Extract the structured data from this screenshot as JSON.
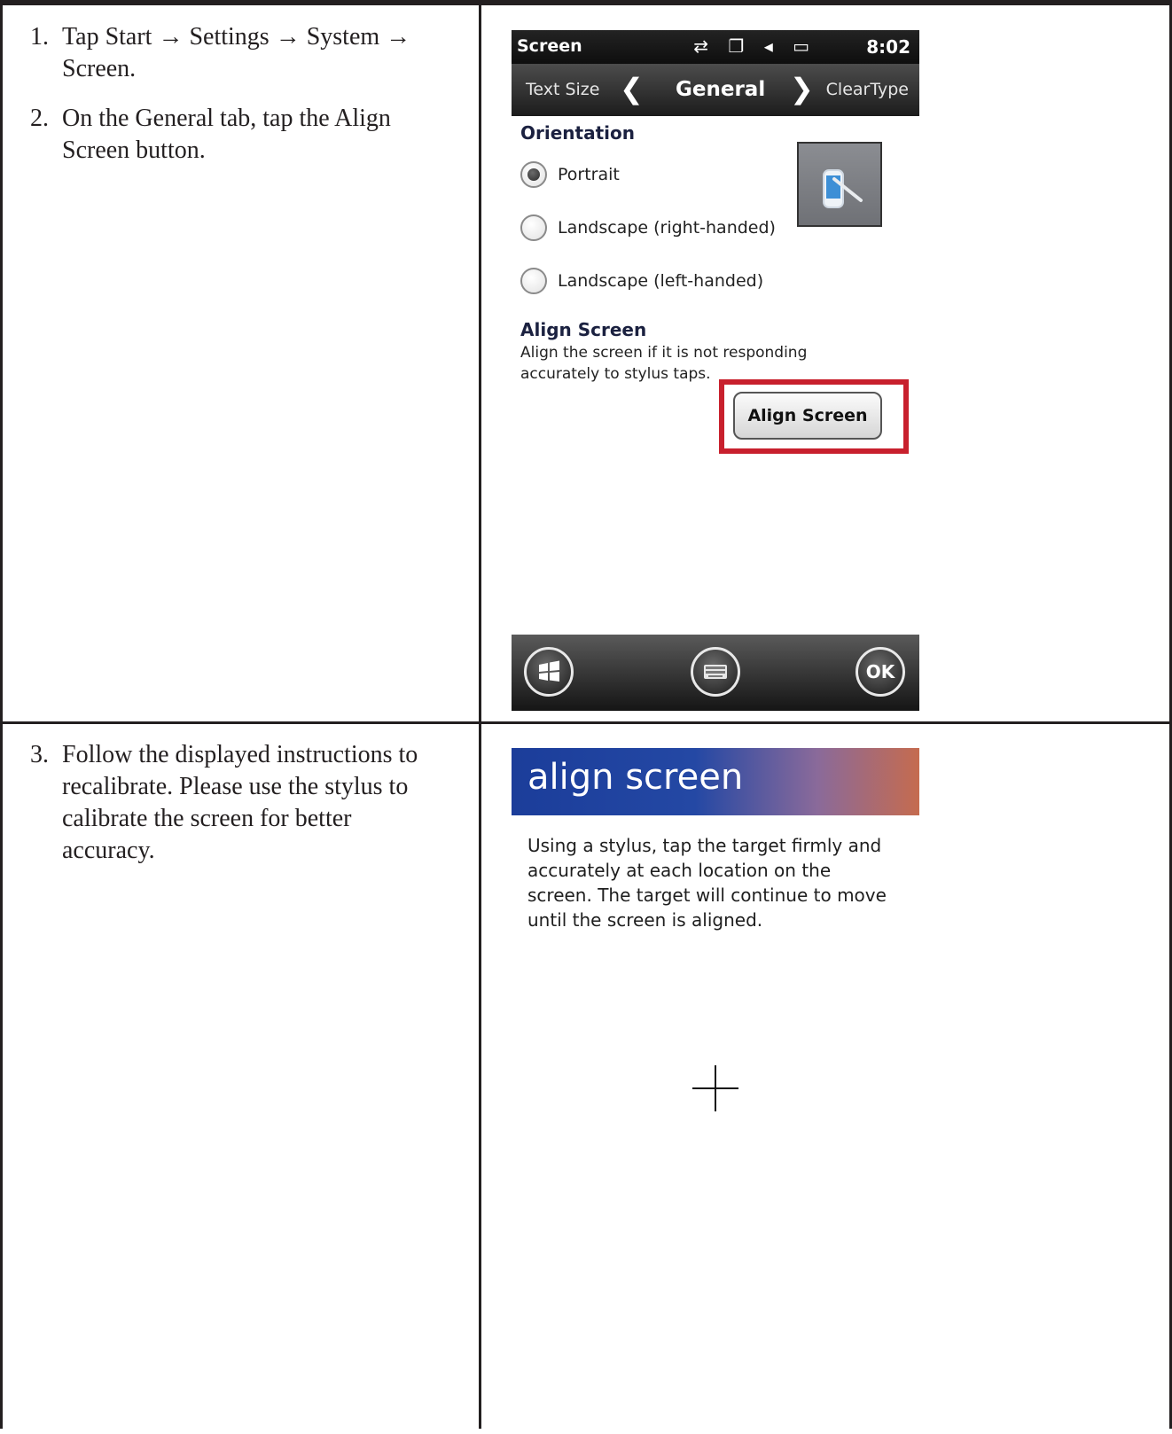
{
  "steps": [
    {
      "num": "1.",
      "text": "Tap Start → Settings → System → Screen."
    },
    {
      "num": "2.",
      "text": "On the General tab, tap the Align Screen button."
    },
    {
      "num": "3.",
      "text": "Follow the displayed instructions to recalibrate. Please use the stylus to calibrate the screen for better accuracy."
    }
  ],
  "screen1": {
    "status": {
      "title": "Screen",
      "icons": "⇄ ❐ ◂ ▭",
      "time": "8:02"
    },
    "tabs": {
      "left": "Text Size",
      "current": "General",
      "right": "ClearType",
      "prev_chevron": "❮",
      "next_chevron": "❯"
    },
    "orientation": {
      "heading": "Orientation",
      "options": [
        {
          "label": "Portrait",
          "selected": true
        },
        {
          "label": "Landscape (right-handed)",
          "selected": false
        },
        {
          "label": "Landscape (left-handed)",
          "selected": false
        }
      ]
    },
    "align": {
      "heading": "Align Screen",
      "description": "Align the screen if it is not responding accurately to stylus taps.",
      "button": "Align Screen",
      "highlight_color": "#c8202d"
    },
    "softkeys": {
      "start_icon": "windows-start-icon",
      "keyboard_icon": "keyboard-icon",
      "ok": "OK"
    }
  },
  "screen2": {
    "title": "align screen",
    "instructions": "Using a stylus, tap the target firmly and accurately at each location on the screen. The target will continue to move until the screen is aligned.",
    "target_icon": "crosshair-icon"
  }
}
